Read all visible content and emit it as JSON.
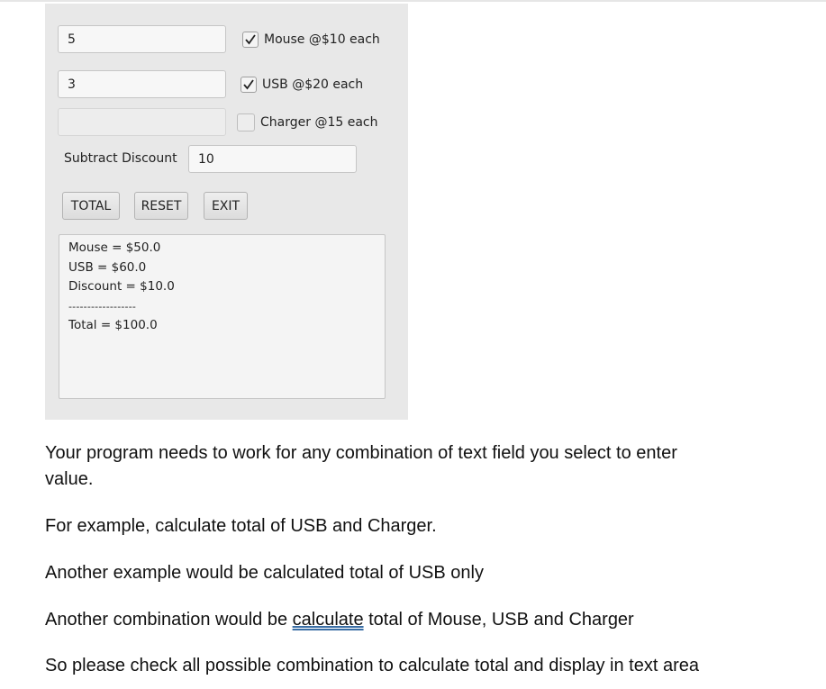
{
  "form": {
    "mouse_qty": "5",
    "usb_qty": "3",
    "charger_qty": "",
    "mouse_checkbox_label": "Mouse @$10 each",
    "usb_checkbox_label": "USB @$20 each",
    "charger_checkbox_label": "Charger @15 each",
    "mouse_checked": true,
    "usb_checked": true,
    "charger_checked": false,
    "discount_label": "Subtract Discount",
    "discount_value": "10"
  },
  "buttons": {
    "total": "TOTAL",
    "reset": "RESET",
    "exit": "EXIT"
  },
  "output": {
    "lines": [
      "Mouse = $50.0",
      "USB = $60.0",
      "Discount = $10.0",
      "------------------",
      "Total = $100.0"
    ]
  },
  "instructions": {
    "p1_line1": "Your program needs to work for any combination of text field you select to enter",
    "p1_line2": "value.",
    "p2": "For example, calculate total of USB and Charger.",
    "p3": "Another example would be calculated total of USB only",
    "p4_before": "Another combination would be ",
    "p4_word": "calculate",
    "p4_after": " total of Mouse, USB and Charger",
    "p5": "So please check all possible combination to calculate total and display in text area"
  }
}
